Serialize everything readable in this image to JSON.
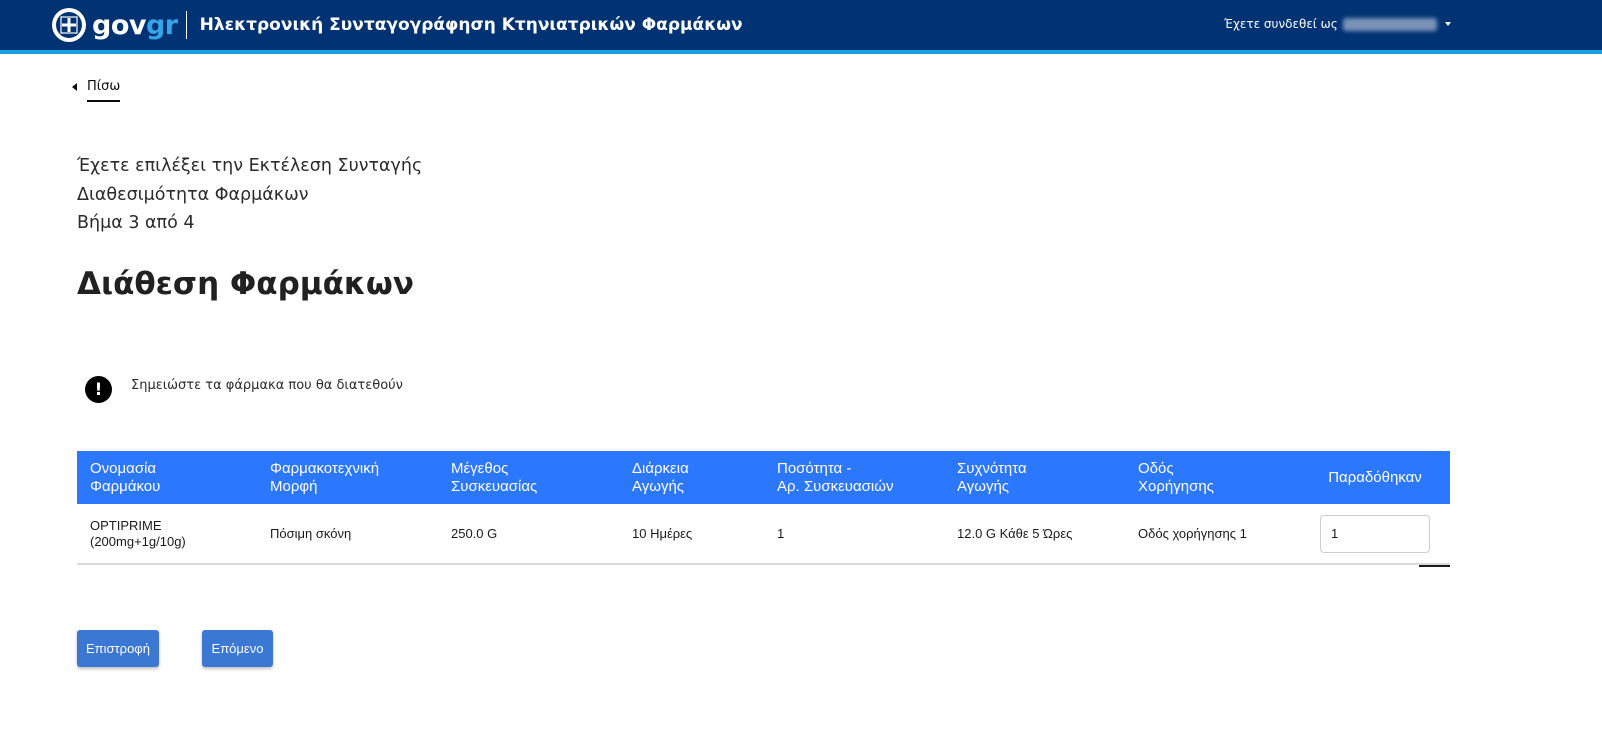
{
  "header": {
    "logo_main": "gov",
    "logo_accent": "gr",
    "site_title": "Ηλεκτρονική Συνταγογράφηση Κτηνιατρικών Φαρμάκων",
    "logged_in_label": "Έχετε συνδεθεί ως",
    "colors": {
      "bar": "#013374",
      "accent_line": "#1a9fe0",
      "logo_accent": "#36a4e6"
    },
    "icons": {
      "emblem": "greek-state-emblem-icon",
      "user_menu": "caret-down-icon"
    }
  },
  "back_link": {
    "label": "Πίσω",
    "icon": "caret-left-icon"
  },
  "step_info": {
    "selected_action": "Έχετε επιλέξει την Εκτέλεση Συνταγής",
    "section": "Διαθεσιμότητα Φαρμάκων",
    "step": "Βήμα 3 από 4"
  },
  "page_title": "Διάθεση Φαρμάκων",
  "notice": {
    "icon": "exclamation-circle-icon",
    "text": "Σημειώστε τα φάρμακα που θα διατεθούν"
  },
  "table": {
    "header_color": "#2b78ff",
    "columns": [
      {
        "line1": "Ονομασία",
        "line2": "Φαρμάκου"
      },
      {
        "line1": "Φαρμακοτεχνική",
        "line2": "Μορφή"
      },
      {
        "line1": "Μέγεθος",
        "line2": "Συσκευασίας"
      },
      {
        "line1": "Διάρκεια",
        "line2": "Αγωγής"
      },
      {
        "line1": "Ποσότητα -",
        "line2": "Αρ. Συσκευασιών"
      },
      {
        "line1": "Συχνότητα",
        "line2": "Αγωγής"
      },
      {
        "line1": "Οδός",
        "line2": "Χορήγησης"
      },
      {
        "line1": "Παραδόθηκαν",
        "line2": ""
      }
    ],
    "rows": [
      {
        "name_line1": "OPTIPRIME",
        "name_line2": "(200mg+1g/10g)",
        "form": "Πόσιμη σκόνη",
        "package_size": "250.0 G",
        "duration": "10 Ημέρες",
        "quantity": "1",
        "frequency": "12.0 G Κάθε 5 Ώρες",
        "route": "Οδός χορήγησης 1",
        "delivered": "1"
      }
    ]
  },
  "buttons": {
    "back": "Επιστροφή",
    "next": "Επόμενο",
    "color": "#3a78d4"
  }
}
